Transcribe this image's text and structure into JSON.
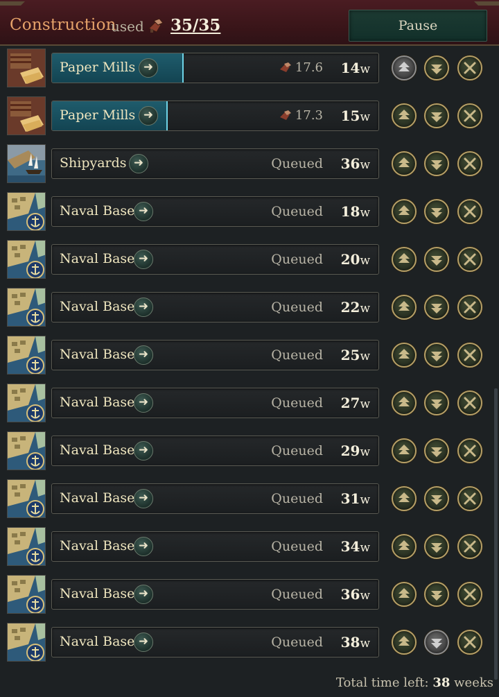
{
  "header": {
    "title": "Construction",
    "used_label": "used",
    "used_count": "35/35",
    "pause_label": "Pause"
  },
  "queue": [
    {
      "name": "Paper Mills",
      "thumb": "paper-mills",
      "cost": "17.6",
      "status": "",
      "weeks": "14",
      "progress": 0.4,
      "up_enabled": false,
      "down_enabled": true
    },
    {
      "name": "Paper Mills",
      "thumb": "paper-mills",
      "cost": "17.3",
      "status": "",
      "weeks": "15",
      "progress": 0.35,
      "up_enabled": true,
      "down_enabled": true
    },
    {
      "name": "Shipyards",
      "thumb": "shipyards",
      "cost": "",
      "status": "Queued",
      "weeks": "36",
      "progress": 0,
      "up_enabled": true,
      "down_enabled": true
    },
    {
      "name": "Naval Base",
      "thumb": "naval-base",
      "cost": "",
      "status": "Queued",
      "weeks": "18",
      "progress": 0,
      "up_enabled": true,
      "down_enabled": true
    },
    {
      "name": "Naval Base",
      "thumb": "naval-base",
      "cost": "",
      "status": "Queued",
      "weeks": "20",
      "progress": 0,
      "up_enabled": true,
      "down_enabled": true
    },
    {
      "name": "Naval Base",
      "thumb": "naval-base",
      "cost": "",
      "status": "Queued",
      "weeks": "22",
      "progress": 0,
      "up_enabled": true,
      "down_enabled": true
    },
    {
      "name": "Naval Base",
      "thumb": "naval-base",
      "cost": "",
      "status": "Queued",
      "weeks": "25",
      "progress": 0,
      "up_enabled": true,
      "down_enabled": true
    },
    {
      "name": "Naval Base",
      "thumb": "naval-base",
      "cost": "",
      "status": "Queued",
      "weeks": "27",
      "progress": 0,
      "up_enabled": true,
      "down_enabled": true
    },
    {
      "name": "Naval Base",
      "thumb": "naval-base",
      "cost": "",
      "status": "Queued",
      "weeks": "29",
      "progress": 0,
      "up_enabled": true,
      "down_enabled": true
    },
    {
      "name": "Naval Base",
      "thumb": "naval-base",
      "cost": "",
      "status": "Queued",
      "weeks": "31",
      "progress": 0,
      "up_enabled": true,
      "down_enabled": true
    },
    {
      "name": "Naval Base",
      "thumb": "naval-base",
      "cost": "",
      "status": "Queued",
      "weeks": "34",
      "progress": 0,
      "up_enabled": true,
      "down_enabled": true
    },
    {
      "name": "Naval Base",
      "thumb": "naval-base",
      "cost": "",
      "status": "Queued",
      "weeks": "36",
      "progress": 0,
      "up_enabled": true,
      "down_enabled": true
    },
    {
      "name": "Naval Base",
      "thumb": "naval-base",
      "cost": "",
      "status": "Queued",
      "weeks": "38",
      "progress": 0,
      "up_enabled": true,
      "down_enabled": false
    }
  ],
  "weeks_unit": "w",
  "footer": {
    "label": "Total time left:",
    "value": "38",
    "unit": "weeks"
  },
  "colors": {
    "header_bg": "#3a1519",
    "title": "#e6a26a",
    "progress_fill": "#1f5c6c",
    "progress_edge": "#6fd3e6",
    "button_ring": "#b7a067"
  }
}
